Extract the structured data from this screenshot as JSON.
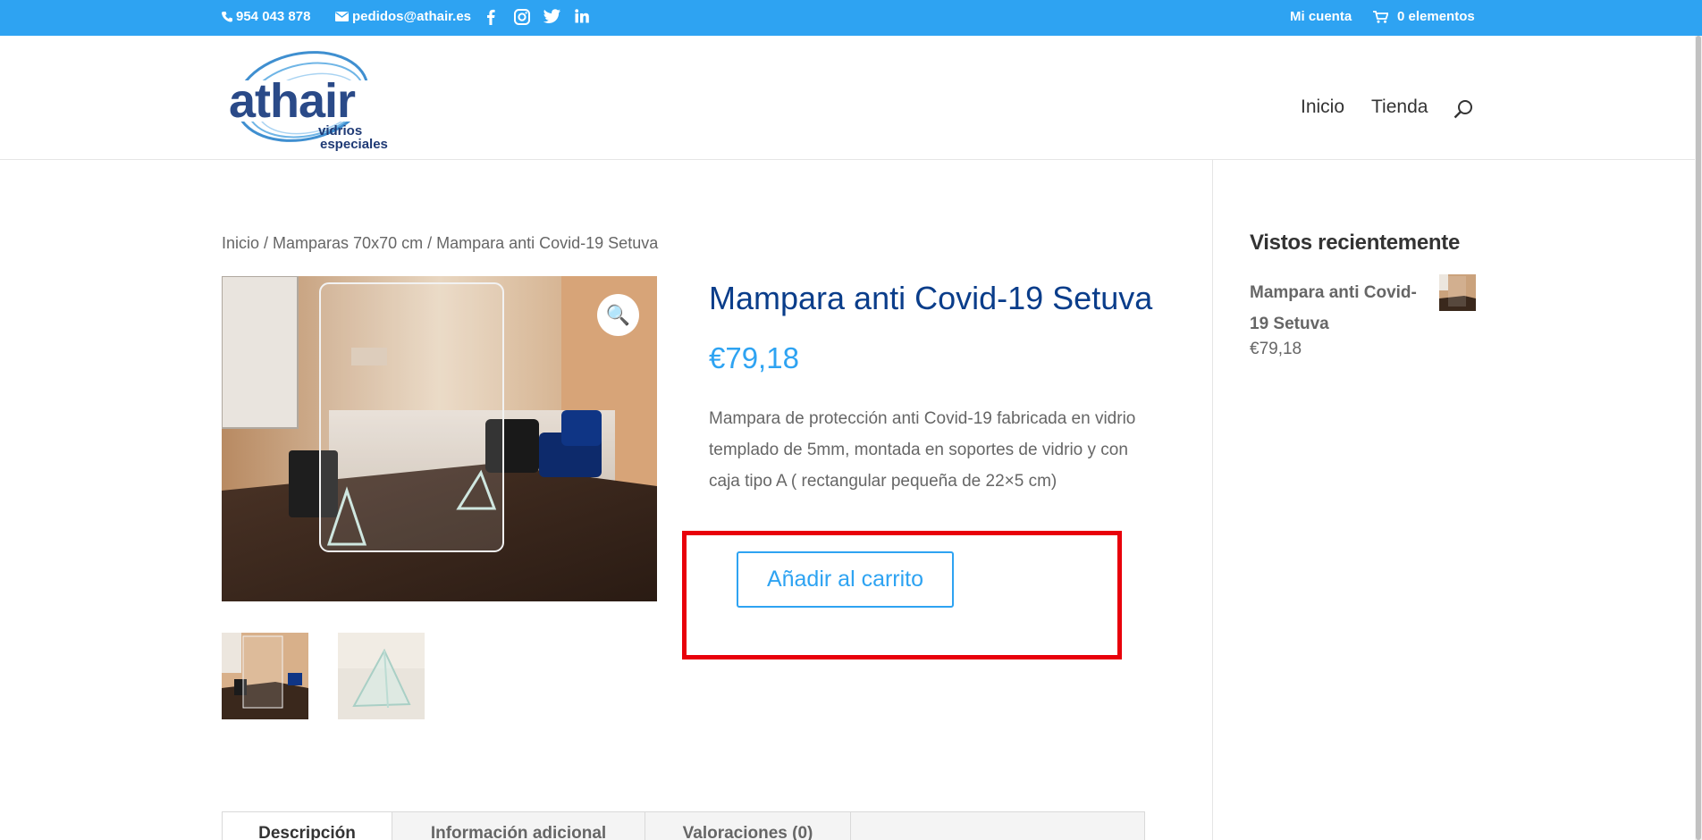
{
  "topbar": {
    "phone": "954 043 878",
    "email": "pedidos@athair.es",
    "social_icons": [
      "facebook-icon",
      "instagram-icon",
      "twitter-icon",
      "linkedin-icon"
    ],
    "account": "Mi cuenta",
    "cart": "0 elementos"
  },
  "logo": {
    "brand": "athair",
    "line1": "vidrios",
    "line2": "especiales"
  },
  "nav": {
    "items": [
      "Inicio",
      "Tienda"
    ],
    "search_icon": "search-icon"
  },
  "breadcrumb": "Inicio / Mamparas 70x70 cm / Mampara anti Covid-19 Setuva",
  "product": {
    "title": "Mampara anti Covid-19 Setuva",
    "price": "€79,18",
    "description": "Mampara de protección anti Covid-19 fabricada en vidrio templado de 5mm, montada en soportes de vidrio y con caja tipo A ( rectangular pequeña de 22×5 cm)",
    "add_to_cart": "Añadir al carrito",
    "zoom_icon": "🔍"
  },
  "tabs": [
    "Descripción",
    "Información adicional",
    "Valoraciones (0)"
  ],
  "sidebar": {
    "title": "Vistos recientemente",
    "product_name": "Mampara anti Covid-19 Setuva",
    "product_price": "€79,18"
  },
  "colors": {
    "topbar": "#2ea3f2",
    "accent": "#2ea3f2",
    "title": "#0a3d8a",
    "highlight": "#e8000b"
  }
}
